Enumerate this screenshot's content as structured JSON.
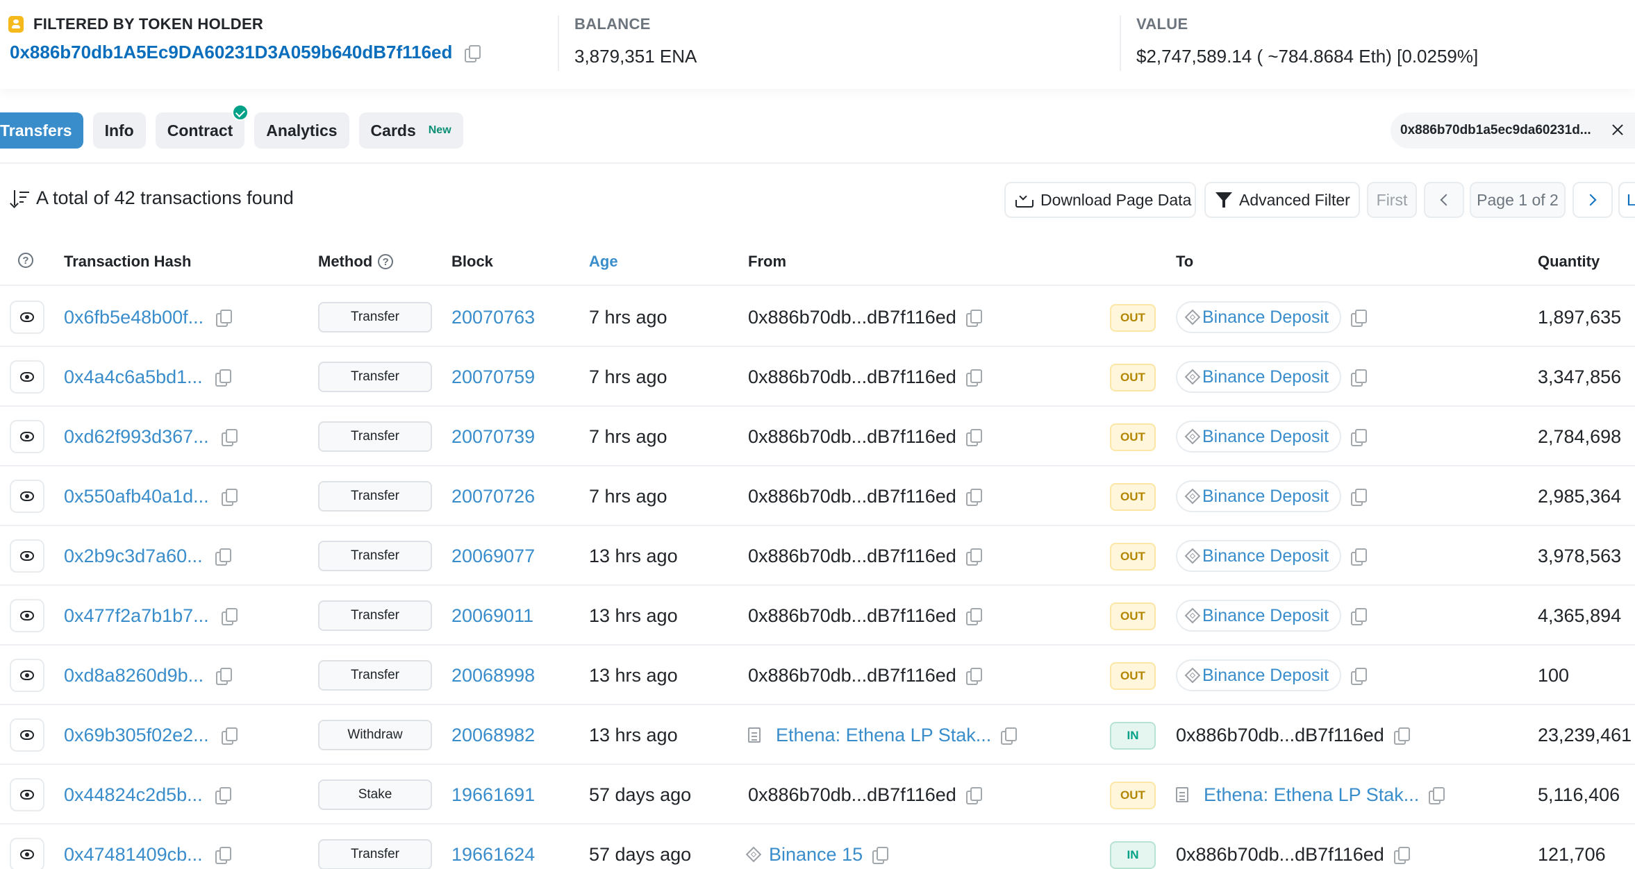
{
  "summary": {
    "holder_label": "FILTERED BY TOKEN HOLDER",
    "holder_address": "0x886b70db1A5Ec9DA60231D3A059b640dB7f116ed",
    "balance_label": "BALANCE",
    "balance_value": "3,879,351 ENA",
    "value_label": "VALUE",
    "value_value": "$2,747,589.14 ( ~784.8684 Eth) [0.0259%]"
  },
  "tabs": [
    {
      "label": "Transfers",
      "active": true
    },
    {
      "label": "Info"
    },
    {
      "label": "Contract",
      "verified": true
    },
    {
      "label": "Analytics"
    },
    {
      "label": "Cards",
      "badge": "New"
    }
  ],
  "filter_chip": {
    "text": "0x886b70db1a5ec9da60231d..."
  },
  "toolbar": {
    "total_text": "A total of 42 transactions found",
    "download_label": "Download Page Data",
    "advanced_filter_label": "Advanced Filter",
    "first_label": "First",
    "page_label": "Page 1 of 2",
    "last_label": "L"
  },
  "columns": {
    "hash": "Transaction Hash",
    "method": "Method",
    "block": "Block",
    "age": "Age",
    "from": "From",
    "to": "To",
    "quantity": "Quantity"
  },
  "rows": [
    {
      "hash": "0x6fb5e48b00f...",
      "method": "Transfer",
      "block": "20070763",
      "age": "7 hrs ago",
      "from": "0x886b70db...dB7f116ed",
      "dir": "OUT",
      "to": "Binance Deposit",
      "qty": "1,897,635"
    },
    {
      "hash": "0x4a4c6a5bd1...",
      "method": "Transfer",
      "block": "20070759",
      "age": "7 hrs ago",
      "from": "0x886b70db...dB7f116ed",
      "dir": "OUT",
      "to": "Binance Deposit",
      "qty": "3,347,856"
    },
    {
      "hash": "0xd62f993d367...",
      "method": "Transfer",
      "block": "20070739",
      "age": "7 hrs ago",
      "from": "0x886b70db...dB7f116ed",
      "dir": "OUT",
      "to": "Binance Deposit",
      "qty": "2,784,698"
    },
    {
      "hash": "0x550afb40a1d...",
      "method": "Transfer",
      "block": "20070726",
      "age": "7 hrs ago",
      "from": "0x886b70db...dB7f116ed",
      "dir": "OUT",
      "to": "Binance Deposit",
      "qty": "2,985,364"
    },
    {
      "hash": "0x2b9c3d7a60...",
      "method": "Transfer",
      "block": "20069077",
      "age": "13 hrs ago",
      "from": "0x886b70db...dB7f116ed",
      "dir": "OUT",
      "to": "Binance Deposit",
      "qty": "3,978,563"
    },
    {
      "hash": "0x477f2a7b1b7...",
      "method": "Transfer",
      "block": "20069011",
      "age": "13 hrs ago",
      "from": "0x886b70db...dB7f116ed",
      "dir": "OUT",
      "to": "Binance Deposit",
      "qty": "4,365,894"
    },
    {
      "hash": "0xd8a8260d9b...",
      "method": "Transfer",
      "block": "20068998",
      "age": "13 hrs ago",
      "from": "0x886b70db...dB7f116ed",
      "dir": "OUT",
      "to": "Binance Deposit",
      "qty": "100"
    },
    {
      "hash": "0x69b305f02e2...",
      "method": "Withdraw",
      "block": "20068982",
      "age": "13 hrs ago",
      "from": "Ethena: Ethena LP Stak...",
      "dir": "IN",
      "to": "0x886b70db...dB7f116ed",
      "qty": "23,239,461"
    },
    {
      "hash": "0x44824c2d5b...",
      "method": "Stake",
      "block": "19661691",
      "age": "57 days ago",
      "from": "0x886b70db...dB7f116ed",
      "dir": "OUT",
      "to": "Ethena: Ethena LP Stak...",
      "qty": "5,116,406"
    },
    {
      "hash": "0x47481409cb...",
      "method": "Transfer",
      "block": "19661624",
      "age": "57 days ago",
      "from": "Binance 15",
      "dir": "IN",
      "to": "0x886b70db...dB7f116ed",
      "qty": "121,706"
    }
  ]
}
